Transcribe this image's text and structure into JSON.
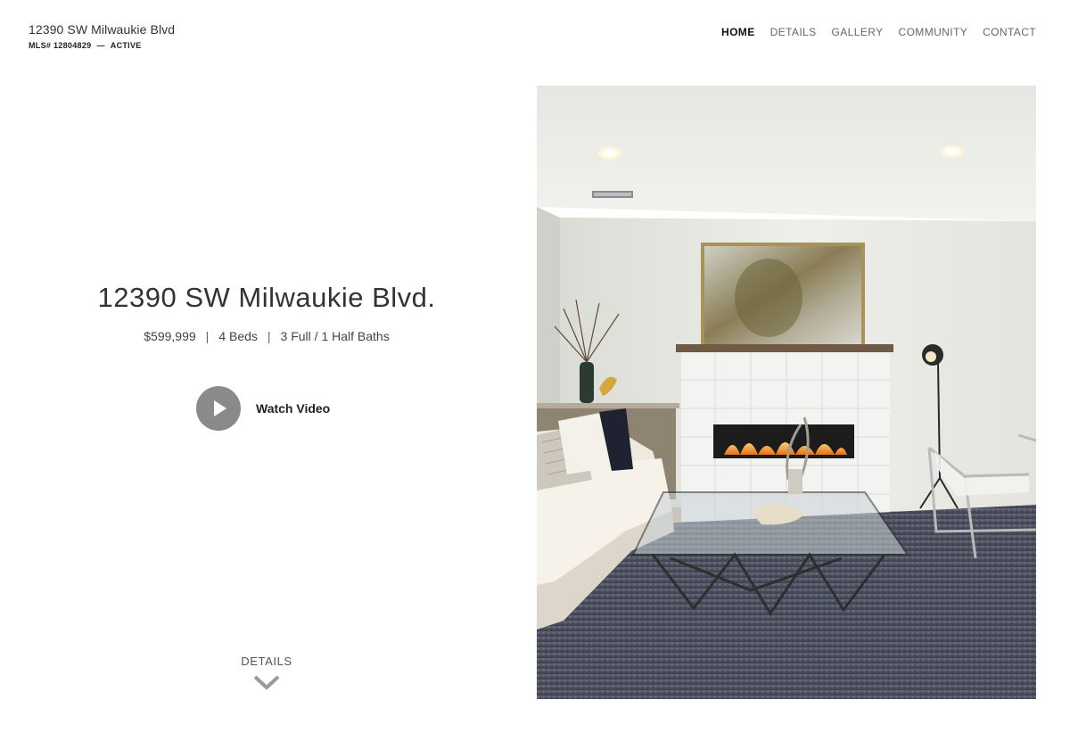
{
  "header": {
    "title": "12390 SW Milwaukie Blvd",
    "mls": "MLS# 12804829",
    "separator": "—",
    "status": "ACTIVE"
  },
  "nav": {
    "items": [
      {
        "label": "HOME",
        "active": true
      },
      {
        "label": "DETAILS",
        "active": false
      },
      {
        "label": "GALLERY",
        "active": false
      },
      {
        "label": "COMMUNITY",
        "active": false
      },
      {
        "label": "CONTACT",
        "active": false
      }
    ]
  },
  "hero": {
    "title": "12390 SW Milwaukie Blvd.",
    "price": "$599,999",
    "beds": "4 Beds",
    "baths": "3 Full / 1 Half Baths",
    "pipe": "|",
    "watch_label": "Watch Video",
    "details_label": "DETAILS"
  },
  "icons": {
    "play": "play-icon",
    "details_arrow": "chevron-down-icon"
  },
  "colors": {
    "play_button": "#8a8a8a",
    "nav_active": "#111111",
    "nav_inactive": "#666666"
  }
}
